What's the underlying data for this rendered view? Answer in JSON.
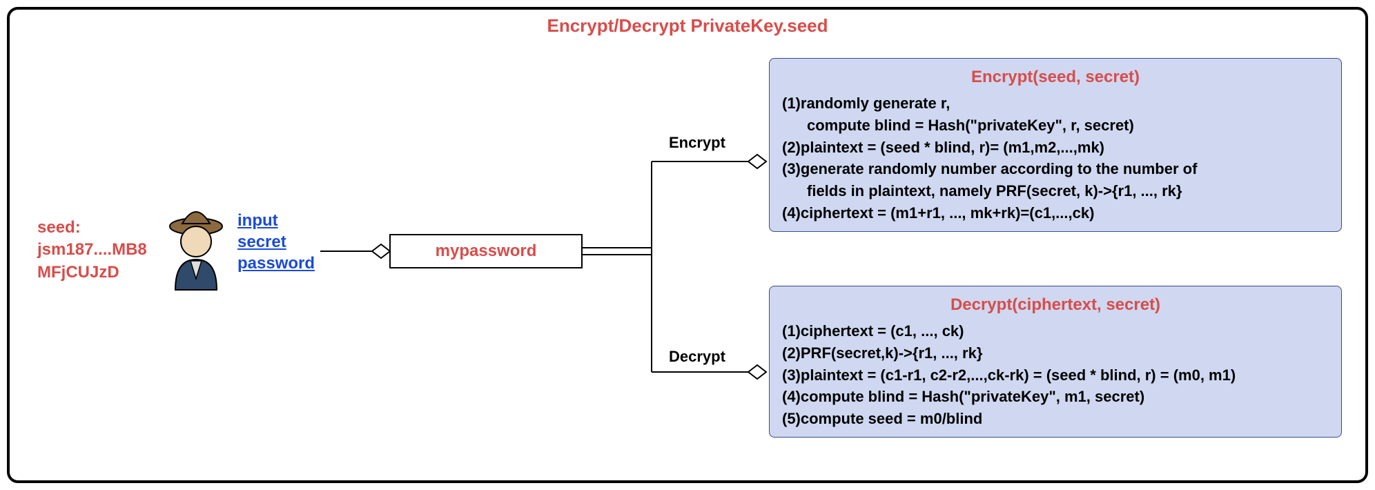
{
  "title": "Encrypt/Decrypt PrivateKey.seed",
  "seed": {
    "label": "seed:",
    "line1": "jsm187....MB8",
    "line2": "MFjCUJzD"
  },
  "inputLabels": {
    "l1": "input",
    "l2": "secret",
    "l3": "password"
  },
  "password": "mypassword",
  "branches": {
    "encrypt": "Encrypt",
    "decrypt": "Decrypt"
  },
  "encryptBox": {
    "header": "Encrypt(seed, secret)",
    "s1": "(1)randomly generate r,",
    "s1b": "compute blind = Hash(\"privateKey\", r, secret)",
    "s2": "(2)plaintext = (seed * blind, r)= (m1,m2,...,mk)",
    "s3": "(3)generate randomly number according to the number of",
    "s3b": "fields in plaintext,  namely PRF(secret, k)->{r1, ..., rk}",
    "s4": "(4)ciphertext = (m1+r1, ..., mk+rk)=(c1,...,ck)"
  },
  "decryptBox": {
    "header": "Decrypt(ciphertext, secret)",
    "s1": "(1)ciphertext = (c1, ..., ck)",
    "s2": "(2)PRF(secret,k)->{r1, ..., rk}",
    "s3": "(3)plaintext = (c1-r1, c2-r2,...,ck-rk) = (seed * blind, r) = (m0, m1)",
    "s4": "(4)compute blind = Hash(\"privateKey\", m1, secret)",
    "s5": "(5)compute seed = m0/blind"
  }
}
